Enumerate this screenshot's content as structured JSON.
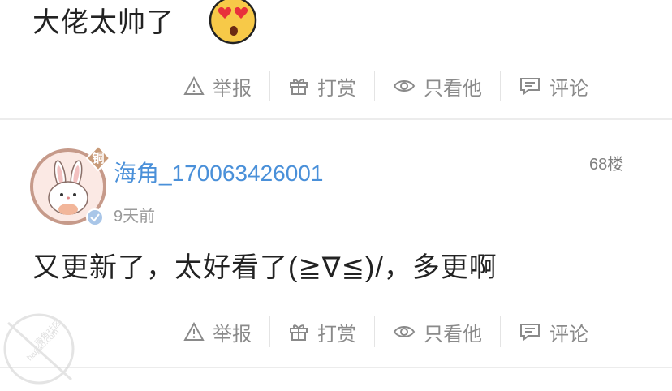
{
  "comment_prev": {
    "text": "大佬太帅了",
    "emoji": "heart-eyes-emoji",
    "actions": {
      "report": "举报",
      "reward": "打赏",
      "only_him": "只看他",
      "comment": "评论"
    }
  },
  "comment_68": {
    "username": "海角_170063426001",
    "floor": "68楼",
    "time": "9天前",
    "badge_top": "铜",
    "text": "又更新了，太好看了(≧∇≦)/，多更啊",
    "actions": {
      "report": "举报",
      "reward": "打赏",
      "only_him": "只看他",
      "comment": "评论"
    }
  },
  "watermark": {
    "line1": "海角社区",
    "line2": "haijiao.com"
  },
  "colors": {
    "username": "#4a90d9",
    "action_text": "#8a8a8a",
    "badge_bronze": "#c89a78"
  }
}
